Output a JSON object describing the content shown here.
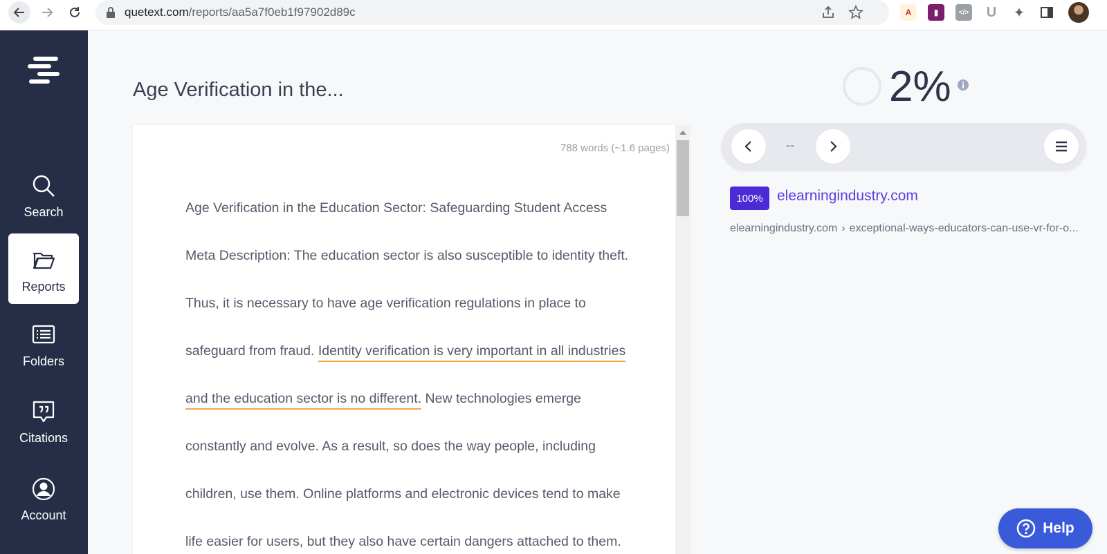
{
  "browser": {
    "url_host": "quetext.com",
    "url_path": "/reports/aa5a7f0eb1f97902d89c"
  },
  "sidebar": {
    "items": [
      {
        "label": "Search",
        "icon": "search-icon"
      },
      {
        "label": "Reports",
        "icon": "folder-open-icon",
        "active": true
      },
      {
        "label": "Folders",
        "icon": "list-icon"
      },
      {
        "label": "Citations",
        "icon": "quote-bubble-icon"
      },
      {
        "label": "Account",
        "icon": "user-circle-icon"
      }
    ]
  },
  "document": {
    "title": "Age Verification in the...",
    "word_count": "788 words (~1.6 pages)",
    "lines": {
      "l1": "Age Verification in the Education Sector: Safeguarding Student Access",
      "l2": "Meta Description: The education sector is also susceptible to identity theft.",
      "l3": "Thus, it is necessary to have age verification regulations in place to",
      "l4a": "safeguard from fraud. ",
      "l4b": "Identity verification is very important in all industries",
      "l5a": "and the education sector is no different.",
      "l5b": " New technologies emerge",
      "l6": "constantly and evolve. As a result, so does the way people, including",
      "l7": "children, use them. Online platforms and electronic devices tend to make",
      "l8": "life easier for users, but they also have certain dangers attached to them."
    }
  },
  "report": {
    "score": "2%",
    "match_index": "--",
    "source": {
      "badge": "100%",
      "title": "elearningindustry.com",
      "crumb_host": "elearningindustry.com",
      "crumb_sep": "›",
      "crumb_path": "exceptional-ways-educators-can-use-vr-for-o..."
    }
  },
  "help": {
    "label": "Help"
  },
  "colors": {
    "sidebar_bg": "#262e47",
    "accent_purple": "#4b2bd6",
    "highlight_orange": "#f5a443",
    "help_blue": "#3a5bd9"
  }
}
